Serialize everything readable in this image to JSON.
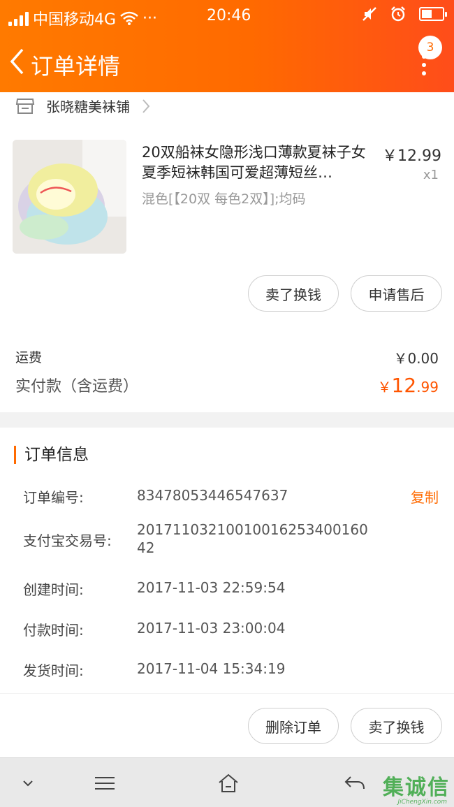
{
  "status_bar": {
    "carrier": "中国移动4G",
    "extra": "···",
    "time": "20:46"
  },
  "header": {
    "title": "订单详情",
    "badge_count": "3"
  },
  "shop": {
    "name": "张晓糖美袜铺"
  },
  "product": {
    "title": "20双船袜女隐形浅口薄款夏袜子女夏季短袜韩国可爱超薄短丝…",
    "price": "￥12.99",
    "quantity": "x1",
    "spec": "混色[【20双 每色2双】];均码",
    "image_icon": "sock-product-photo"
  },
  "product_actions": {
    "sell_label": "卖了换钱",
    "after_sale_label": "申请售后"
  },
  "summary": {
    "shipping_label": "运费",
    "shipping_value": "￥0.00",
    "paid_label": "实付款（含运费）",
    "paid_currency": "￥",
    "paid_integer": "12",
    "paid_decimal": ".99"
  },
  "order_info": {
    "title": "订单信息",
    "copy_label": "复制",
    "rows": [
      {
        "label": "订单编号:",
        "value": "83478053446547637"
      },
      {
        "label": "支付宝交易号:",
        "value": "20171103210010016253400160 42"
      },
      {
        "label": "创建时间:",
        "value": "2017-11-03 22:59:54"
      },
      {
        "label": "付款时间:",
        "value": "2017-11-03 23:00:04"
      },
      {
        "label": "发货时间:",
        "value": "2017-11-04 15:34:19"
      }
    ]
  },
  "bottom_actions": {
    "delete_label": "删除订单",
    "sell_label": "卖了换钱"
  },
  "watermark": {
    "text": "集诚信",
    "sub": "JiChengXin.com"
  },
  "colors": {
    "accent": "#ff6a00",
    "price": "#ff5500"
  }
}
